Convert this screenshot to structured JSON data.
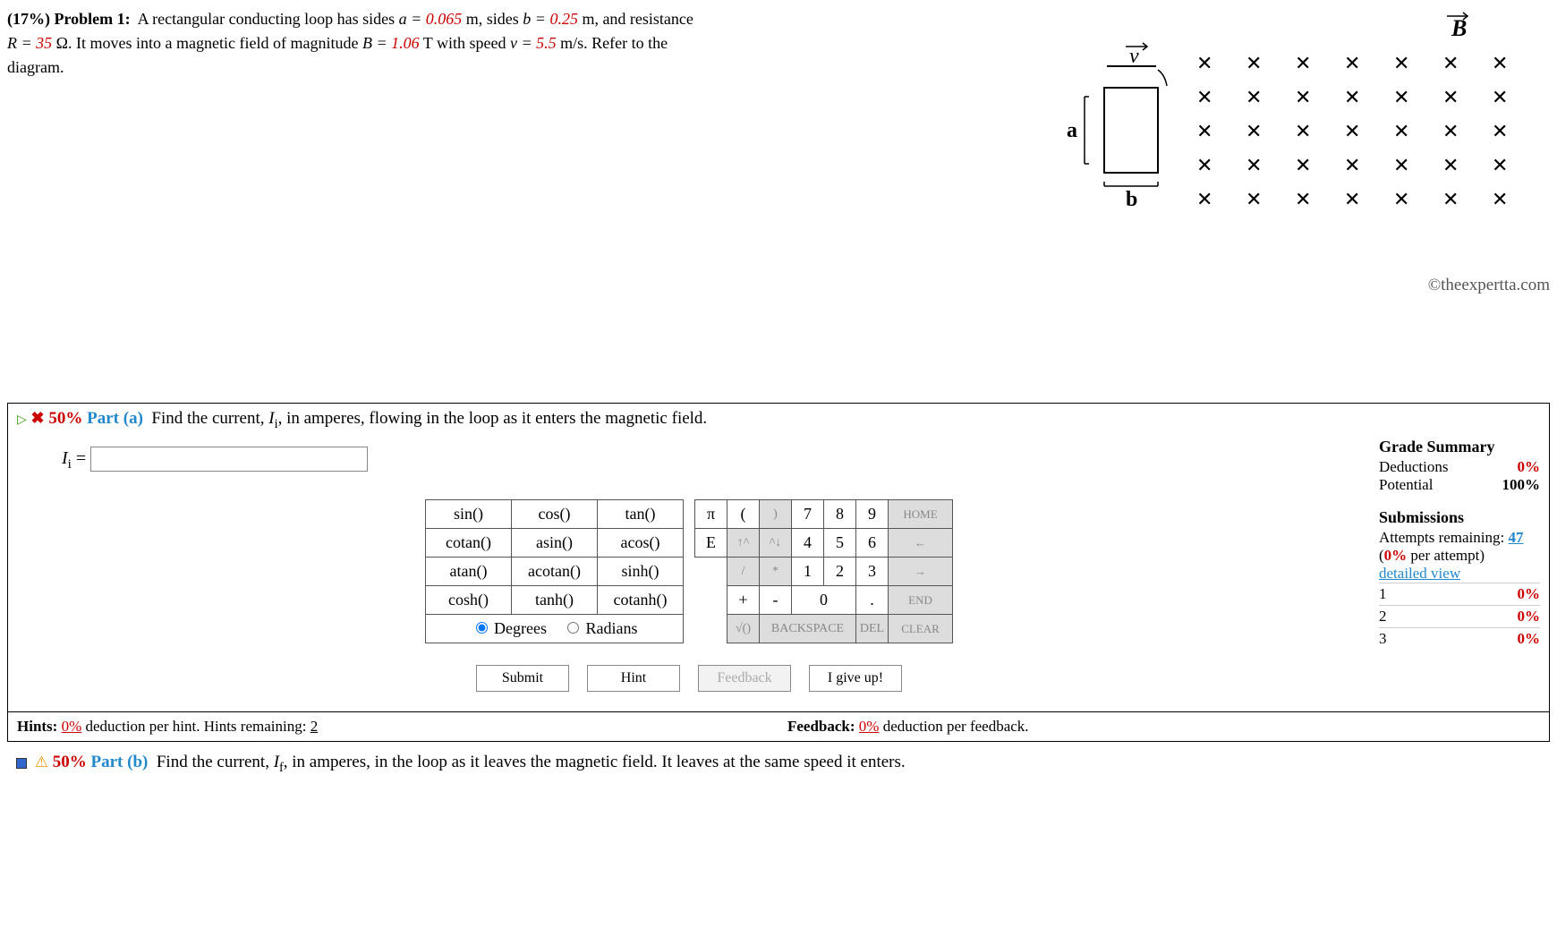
{
  "problem": {
    "weight": "(17%)",
    "title": "Problem 1:",
    "text_before_a": "A rectangular conducting loop has sides ",
    "a_eq": "a = ",
    "a_val": "0.065",
    "a_unit": " m, sides ",
    "b_eq": "b = ",
    "b_val": "0.25",
    "b_unit": " m, and resistance",
    "line2_a": "R = ",
    "R_val": "35",
    "line2_b": " Ω. It moves into a magnetic field of magnitude ",
    "B_eq": "B = ",
    "B_val": "1.06",
    "B_unit": " T with speed ",
    "v_eq": "v = ",
    "v_val": "5.5",
    "v_unit": " m/s. Refer to the",
    "line3": "diagram."
  },
  "diagram": {
    "v_label": "v",
    "B_label": "B",
    "a_label": "a",
    "b_label": "b",
    "x_symbol": "✕"
  },
  "copyright": "©theexpertta.com",
  "part_a": {
    "percent": "50%",
    "label": "Part (a)",
    "prompt_1": "Find the current, ",
    "prompt_var": "I",
    "prompt_sub": "i",
    "prompt_2": ", in amperes, flowing in the loop as it enters the magnetic field.",
    "answer_prefix_var": "I",
    "answer_prefix_sub": "i",
    "answer_eq": " = ",
    "input_value": ""
  },
  "functions": {
    "r1": [
      "sin()",
      "cos()",
      "tan()"
    ],
    "r2": [
      "cotan()",
      "asin()",
      "acos()"
    ],
    "r3": [
      "atan()",
      "acotan()",
      "sinh()"
    ],
    "r4": [
      "cosh()",
      "tanh()",
      "cotanh()"
    ],
    "degrees": "Degrees",
    "radians": "Radians"
  },
  "keypad": {
    "r1": [
      "π",
      "(",
      ")",
      "7",
      "8",
      "9"
    ],
    "r1_end": "HOME",
    "r2": [
      "E",
      "↑^",
      "^↓",
      "4",
      "5",
      "6"
    ],
    "r2_end": "←",
    "r3": [
      "",
      "/",
      "*",
      "1",
      "2",
      "3"
    ],
    "r3_end": "→",
    "r4": [
      "",
      "+",
      "-",
      "0",
      "",
      "."
    ],
    "r4_end": "END",
    "r5a": "√()",
    "r5b": "BACKSPACE",
    "r5c": "DEL",
    "r5d": "CLEAR"
  },
  "buttons": {
    "submit": "Submit",
    "hint": "Hint",
    "feedback": "Feedback",
    "giveup": "I give up!"
  },
  "hints": {
    "label": "Hints:",
    "deduction": "0%",
    "text": " deduction per hint. Hints remaining: ",
    "remaining": "2"
  },
  "feedback": {
    "label": "Feedback:",
    "deduction": "0%",
    "text": " deduction per feedback."
  },
  "grade": {
    "title": "Grade Summary",
    "deductions_label": "Deductions",
    "deductions_val": "0%",
    "potential_label": "Potential",
    "potential_val": "100%"
  },
  "subs": {
    "title": "Submissions",
    "attempts_text": "Attempts remaining: ",
    "attempts_val": "47",
    "per_attempt": "(0% per attempt)",
    "detailed": "detailed view",
    "rows": [
      {
        "n": "1",
        "v": "0%"
      },
      {
        "n": "2",
        "v": "0%"
      },
      {
        "n": "3",
        "v": "0%"
      }
    ]
  },
  "part_b": {
    "percent": "50%",
    "label": "Part (b)",
    "prompt_1": "Find the current, ",
    "prompt_var": "I",
    "prompt_sub": "f",
    "prompt_2": ", in amperes, in the loop as it leaves the magnetic field. It leaves at the same speed it enters."
  }
}
